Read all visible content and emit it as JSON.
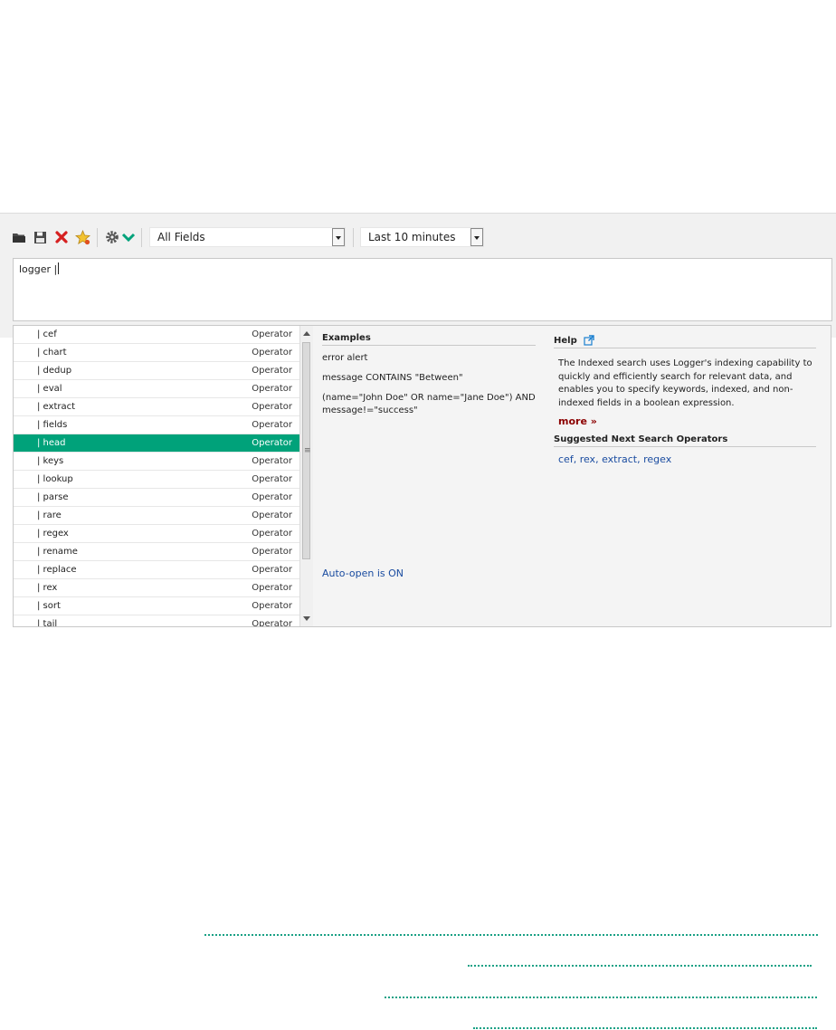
{
  "toolbar": {
    "icons": [
      "folder-open-icon",
      "save-icon",
      "delete-icon",
      "favorite-star-icon",
      "settings-icon",
      "chevron-down-icon"
    ],
    "field_select": "All Fields",
    "time_select": "Last 10 minutes"
  },
  "query": {
    "value": "logger |"
  },
  "operators": [
    {
      "name": "| cef",
      "type": "Operator"
    },
    {
      "name": "| chart",
      "type": "Operator"
    },
    {
      "name": "| dedup",
      "type": "Operator"
    },
    {
      "name": "| eval",
      "type": "Operator"
    },
    {
      "name": "| extract",
      "type": "Operator"
    },
    {
      "name": "| fields",
      "type": "Operator"
    },
    {
      "name": "| head",
      "type": "Operator",
      "selected": true
    },
    {
      "name": "| keys",
      "type": "Operator"
    },
    {
      "name": "| lookup",
      "type": "Operator"
    },
    {
      "name": "| parse",
      "type": "Operator"
    },
    {
      "name": "| rare",
      "type": "Operator"
    },
    {
      "name": "| regex",
      "type": "Operator"
    },
    {
      "name": "| rename",
      "type": "Operator"
    },
    {
      "name": "| replace",
      "type": "Operator"
    },
    {
      "name": "| rex",
      "type": "Operator"
    },
    {
      "name": "| sort",
      "type": "Operator"
    },
    {
      "name": "| tail",
      "type": "Operator"
    }
  ],
  "examples": {
    "title": "Examples",
    "items": [
      "error alert",
      "message CONTAINS \"Between\"",
      "(name=\"John Doe\" OR name=\"Jane Doe\") AND message!=\"success\""
    ],
    "auto_open": "Auto-open is ON"
  },
  "help": {
    "title": "Help",
    "text": "The Indexed search uses Logger's indexing capability to quickly and efficiently search for relevant data, and enables you to specify keywords, indexed, and non-indexed fields in a boolean expression.",
    "more": "more »",
    "suggest_title": "Suggested Next Search Operators",
    "suggest": [
      "cef",
      "rex",
      "extract",
      "regex"
    ]
  },
  "colors": {
    "selected_row": "#00a27a",
    "link": "#1a4ca0",
    "more": "#8b0000",
    "dotted_rule": "#1aa185"
  }
}
